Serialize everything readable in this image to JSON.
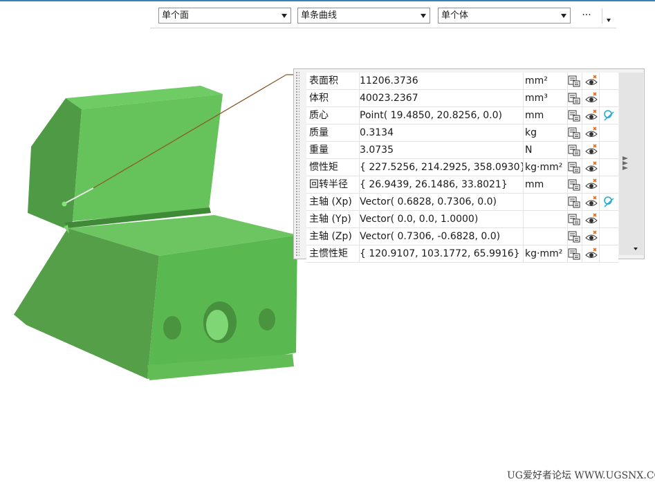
{
  "toolbar": {
    "face_filter": "单个面",
    "curve_filter": "单条曲线",
    "body_filter": "单个体",
    "more": "···"
  },
  "panel": {
    "rows": [
      {
        "label": "表面积",
        "value": "11206.3736",
        "unit": "mm²",
        "has_extra": false
      },
      {
        "label": "体积",
        "value": "40023.2367",
        "unit": "mm³",
        "has_extra": false
      },
      {
        "label": "质心",
        "value": "Point( 19.4850, 20.8256, 0.0)",
        "unit": "mm",
        "has_extra": true
      },
      {
        "label": "质量",
        "value": "0.3134",
        "unit": "kg",
        "has_extra": false
      },
      {
        "label": "重量",
        "value": "3.0735",
        "unit": "N",
        "has_extra": false
      },
      {
        "label": "惯性矩",
        "value": "{ 227.5256, 214.2925, 358.0930}",
        "unit": "kg·mm²",
        "has_extra": false
      },
      {
        "label": "回转半径",
        "value": "{ 26.9439, 26.1486, 33.8021}",
        "unit": "mm",
        "has_extra": false
      },
      {
        "label": "主轴 (Xp)",
        "value": "Vector( 0.6828, 0.7306, 0.0)",
        "unit": "",
        "has_extra": true
      },
      {
        "label": "主轴 (Yp)",
        "value": "Vector( 0.0, 0.0, 1.0000)",
        "unit": "",
        "has_extra": false
      },
      {
        "label": "主轴 (Zp)",
        "value": "Vector( 0.7306, -0.6828, 0.0)",
        "unit": "",
        "has_extra": false
      },
      {
        "label": "主惯性矩",
        "value": "{ 120.9107, 103.1772, 65.9916}",
        "unit": "kg·mm²",
        "has_extra": false
      }
    ]
  },
  "icons": {
    "col1": "export-table-icon",
    "col2": "show-hide-icon",
    "col3": "create-point-icon"
  },
  "colors": {
    "model_green": "#5cb652",
    "leader_line": "#8b5a2b",
    "highlight_cyan": "#1aa8d8"
  },
  "watermark": "UG爱好者论坛 WWW.UGSNX.COM"
}
